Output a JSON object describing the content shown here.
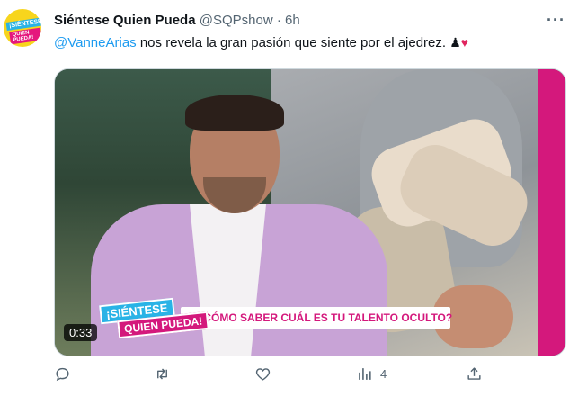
{
  "tweet": {
    "author_name": "Siéntese Quien Pueda",
    "handle": "@SQPshow",
    "separator": " · ",
    "time": "6h",
    "more_label": "···",
    "mention": "@VanneArias",
    "text": " nos revela la gran pasión que siente por el ajedrez. ",
    "emoji_pawn": "♟",
    "emoji_heart": "♥"
  },
  "avatar": {
    "line1": "¡SIÉNTESE",
    "line2": "QUIEN PUEDA!"
  },
  "video": {
    "logo_line1": "¡SIÉNTESE",
    "logo_line2": "QUIEN PUEDA!",
    "caption": "¿CÓMO SABER CUÁL ES TU TALENTO OCULTO?",
    "duration": "0:33"
  },
  "actions": {
    "reply_count": "",
    "retweet_count": "",
    "like_count": "",
    "views_count": "4"
  },
  "icons": {
    "reply": "reply-icon",
    "retweet": "retweet-icon",
    "like": "heart-icon",
    "views": "views-icon",
    "share": "share-icon"
  },
  "colors": {
    "link": "#1d9bf0",
    "muted": "#536471",
    "brand_pink": "#d4187c",
    "brand_blue": "#29b3e6",
    "brand_yellow": "#f7d51d"
  }
}
